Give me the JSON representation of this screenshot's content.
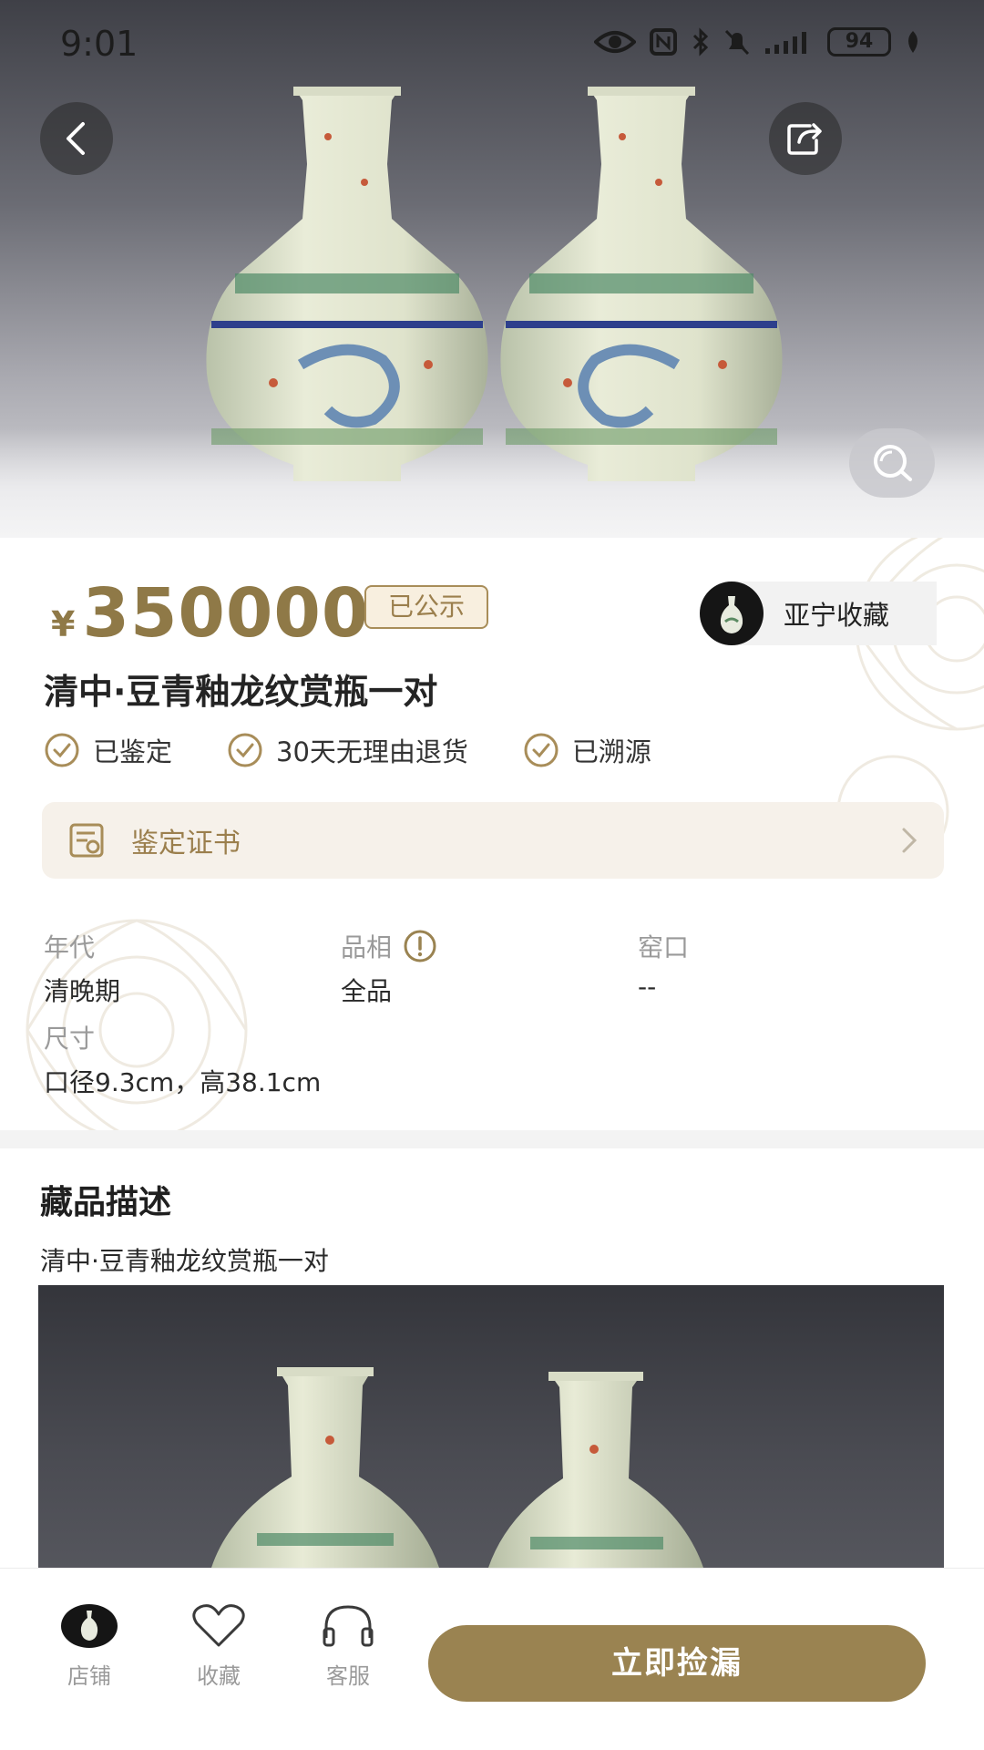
{
  "status_bar": {
    "time": "9:01",
    "battery": "94",
    "icons": [
      "eye-icon",
      "nfc-icon",
      "bluetooth-icon",
      "mute-bell-icon",
      "signal-icon",
      "battery-icon",
      "leaf-icon"
    ]
  },
  "header": {
    "back_icon": "chevron-left-icon",
    "share_icon": "share-icon",
    "zoom_icon": "search-icon"
  },
  "product": {
    "currency": "¥",
    "price": "350000",
    "public_tag": "已公示",
    "title": "清中·豆青釉龙纹赏瓶一对",
    "badges": [
      {
        "label": "已鉴定",
        "icon": "check-circle-icon"
      },
      {
        "label": "30天无理由退货",
        "icon": "check-circle-icon"
      },
      {
        "label": "已溯源",
        "icon": "check-circle-icon"
      }
    ]
  },
  "shop": {
    "name": "亚宁收藏"
  },
  "certificate": {
    "label": "鉴定证书",
    "icon": "certificate-icon",
    "arrow": "chevron-right-icon"
  },
  "attributes": {
    "era": {
      "key": "年代",
      "value": "清晚期"
    },
    "condition": {
      "key": "品相",
      "value": "全品"
    },
    "kiln": {
      "key": "窑口",
      "value": "--"
    },
    "size": {
      "key": "尺寸",
      "value": "口径9.3cm，高38.1cm"
    }
  },
  "description": {
    "heading": "藏品描述",
    "text": "清中·豆青釉龙纹赏瓶一对"
  },
  "bottom_bar": {
    "tabs": [
      {
        "label": "店铺",
        "icon": "shop-avatar-icon"
      },
      {
        "label": "收藏",
        "icon": "heart-icon"
      },
      {
        "label": "客服",
        "icon": "headset-icon"
      }
    ],
    "buy_label": "立即捡漏"
  },
  "colors": {
    "accent_gold": "#8f7947",
    "button_gold": "#9a8351",
    "tag_bg": "#f8efdf",
    "cert_bg": "#f6f1ea"
  }
}
